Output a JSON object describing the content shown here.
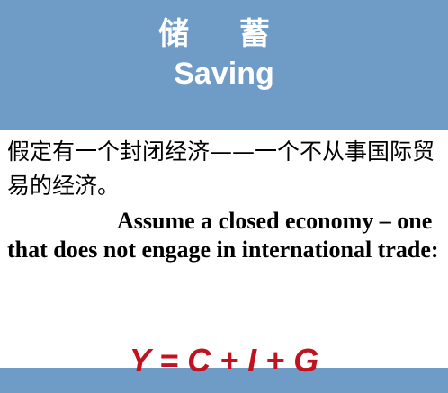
{
  "header": {
    "title_cn": "储 蓄",
    "title_en": "Saving"
  },
  "body": {
    "chinese_text": "假定有一个封闭经济——一个不从事国际贸易的经济。",
    "english_text": "Assume a closed economy – one that does not engage in international trade:"
  },
  "equation": "Y = C + I + G",
  "colors": {
    "header_bg": "#6f9cc7",
    "equation": "#c1121f",
    "text": "#000000"
  }
}
